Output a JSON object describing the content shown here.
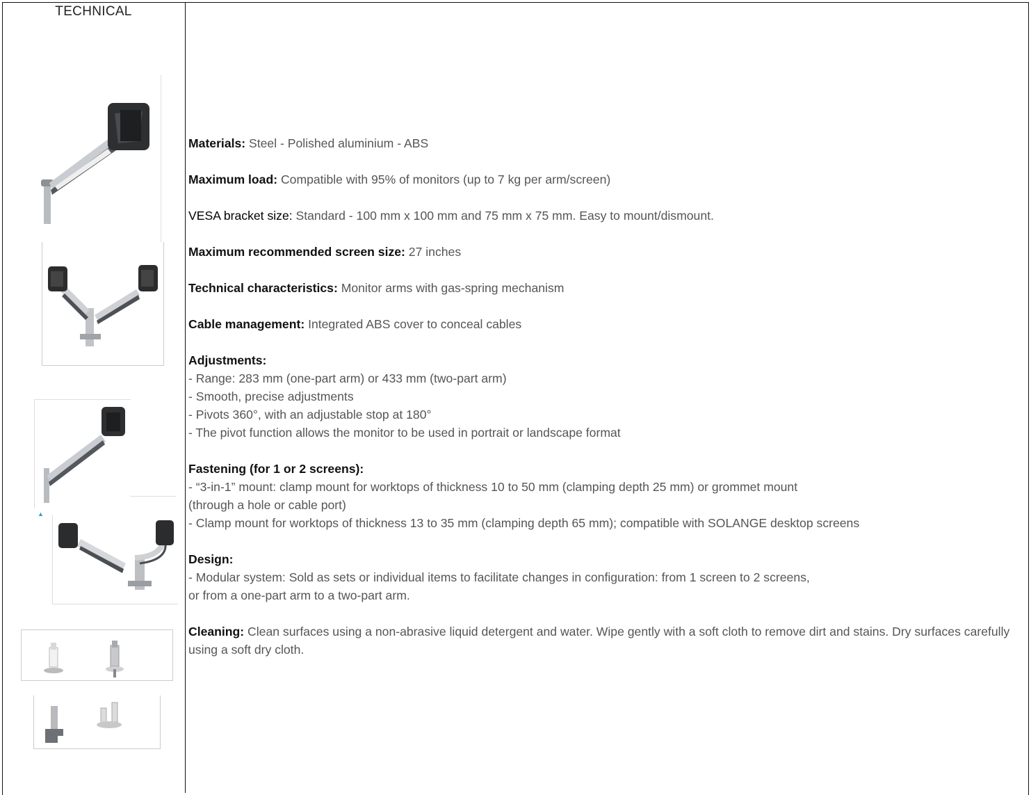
{
  "left_column": {
    "heading": "TECHNICAL"
  },
  "spec": {
    "materials": {
      "label": "Materials:",
      "value": " Steel - Polished aluminium - ABS"
    },
    "max_load": {
      "label": "Maximum load:",
      "value": " Compatible with 95% of monitors (up to 7 kg per arm/screen)"
    },
    "vesa": {
      "label": "VESA bracket size:",
      "value": " Standard - 100 mm x 100 mm and 75 mm x 75 mm. Easy to mount/dismount."
    },
    "screen_size": {
      "label": "Maximum recommended screen size:",
      "value": " 27 inches"
    },
    "tech_char": {
      "label": "Technical characteristics:",
      "value": " Monitor arms with gas-spring mechanism"
    },
    "cable": {
      "label": "Cable management:",
      "value": " Integrated ABS cover to conceal cables"
    },
    "adjustments": {
      "label": "Adjustments:",
      "lines": [
        "- Range: 283 mm (one-part arm) or 433 mm (two-part arm)",
        "- Smooth, precise adjustments",
        "- Pivots 360°, with an adjustable stop at 180°",
        "- The pivot function allows the monitor to be used in portrait or landscape format"
      ]
    },
    "fastening": {
      "label": "Fastening (for 1 or 2 screens):",
      "lines": [
        "- “3-in-1” mount: clamp mount for worktops of thickness 10 to 50 mm (clamping depth 25 mm) or grommet mount",
        "(through a hole or cable port)",
        "- Clamp mount for worktops of thickness 13 to 35 mm (clamping depth 65 mm); compatible with SOLANGE desktop screens"
      ]
    },
    "design": {
      "label": "Design:",
      "lines": [
        "- Modular system: Sold as sets or individual items to facilitate changes in configuration: from 1 screen to 2 screens,",
        "or from a one-part arm to a two-part arm."
      ]
    },
    "cleaning": {
      "label": "Cleaning:",
      "value": " Clean surfaces using a non-abrasive liquid detergent and water. Wipe gently with a soft cloth to remove dirt and stains. Dry surfaces carefully using a soft dry cloth."
    }
  }
}
